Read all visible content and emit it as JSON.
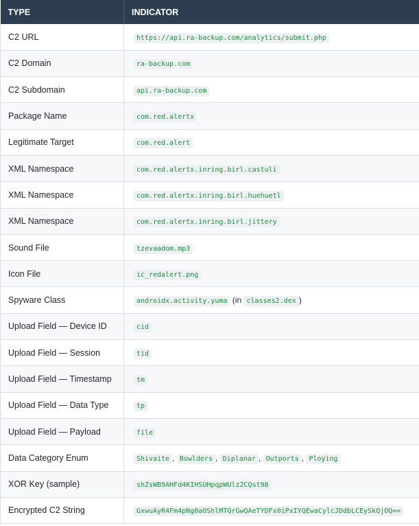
{
  "header": {
    "type": "TYPE",
    "indicator": "INDICATOR"
  },
  "rows": [
    {
      "type": "C2 URL",
      "code": "https://api.ra-backup.com/analytics/submit.php"
    },
    {
      "type": "C2 Domain",
      "code": "ra-backup.com"
    },
    {
      "type": "C2 Subdomain",
      "code": "api.ra-backup.com"
    },
    {
      "type": "Package Name",
      "code": "com.red.alertx"
    },
    {
      "type": "Legitimate Target",
      "code": "com.red.alert"
    },
    {
      "type": "XML Namespace",
      "code": "com.red.alertx.inring.birl.castuli"
    },
    {
      "type": "XML Namespace",
      "code": "com.red.alertx.inring.birl.huehuetl"
    },
    {
      "type": "XML Namespace",
      "code": "com.red.alertx.inring.birl.jittery"
    },
    {
      "type": "Sound File",
      "code": "tzevaadom.mp3"
    },
    {
      "type": "Icon File",
      "code": "ic_redalert.png"
    },
    {
      "type": "Spyware Class",
      "code": "androidx.activity.yuma",
      "text_in": "(in",
      "code2": "classes2.dex",
      "text_close": ")"
    },
    {
      "type": "Upload Field — Device ID",
      "code": "cid"
    },
    {
      "type": "Upload Field — Session",
      "code": "tid"
    },
    {
      "type": "Upload Field — Timestamp",
      "code": "tm"
    },
    {
      "type": "Upload Field — Data Type",
      "code": "tp"
    },
    {
      "type": "Upload Field — Payload",
      "code": "file"
    },
    {
      "type": "Data Category Enum",
      "codes": [
        "Shivaite",
        "Bowlders",
        "Diplanar",
        "Outports",
        "Ploying"
      ],
      "comma": ","
    },
    {
      "type": "XOR Key (sample)",
      "code": "shZsWB9AHFd4KIHSUHpqpWUlz2CQst98"
    },
    {
      "type": "Encrypted C2 String",
      "code": "GxwuAyR4Fm4pNg0aOShlMTQrGwQAeTYDFx0iPxIYQEwaCylcJDdbLCEySkQjOQ=="
    }
  ]
}
